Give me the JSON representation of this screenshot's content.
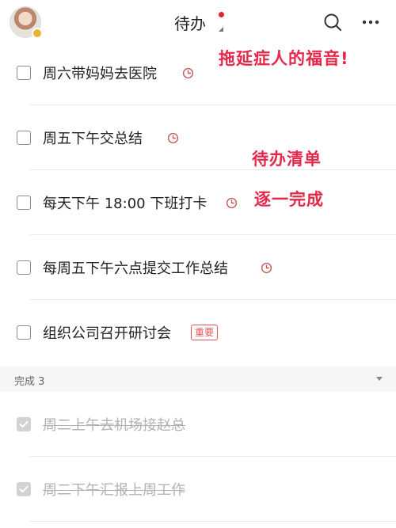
{
  "header": {
    "title": "待办",
    "avatar_badge_color": "#e8b33a",
    "notification_dot_color": "#e0242b"
  },
  "annotations": [
    "拖延症人的福音!",
    "待办清单",
    "逐一完成"
  ],
  "todos": [
    {
      "text": "周六带妈妈去医院",
      "has_reminder": true
    },
    {
      "text": "周五下午交总结",
      "has_reminder": true
    },
    {
      "text": "每天下午 18:00 下班打卡",
      "has_reminder": true
    },
    {
      "text": "每周五下午六点提交工作总结",
      "has_reminder": true
    },
    {
      "text": "组织公司召开研讨会",
      "tag": "重要"
    }
  ],
  "completed_section": {
    "label": "完成 3"
  },
  "completed": [
    {
      "text": "周二上午去机场接赵总"
    },
    {
      "text": "周二下午汇报上周工作"
    }
  ],
  "colors": {
    "accent_red": "#e5284a",
    "tag_red": "#e0565b"
  },
  "icons": [
    "search-icon",
    "more-icon",
    "clock-icon",
    "chevron-down-icon"
  ]
}
